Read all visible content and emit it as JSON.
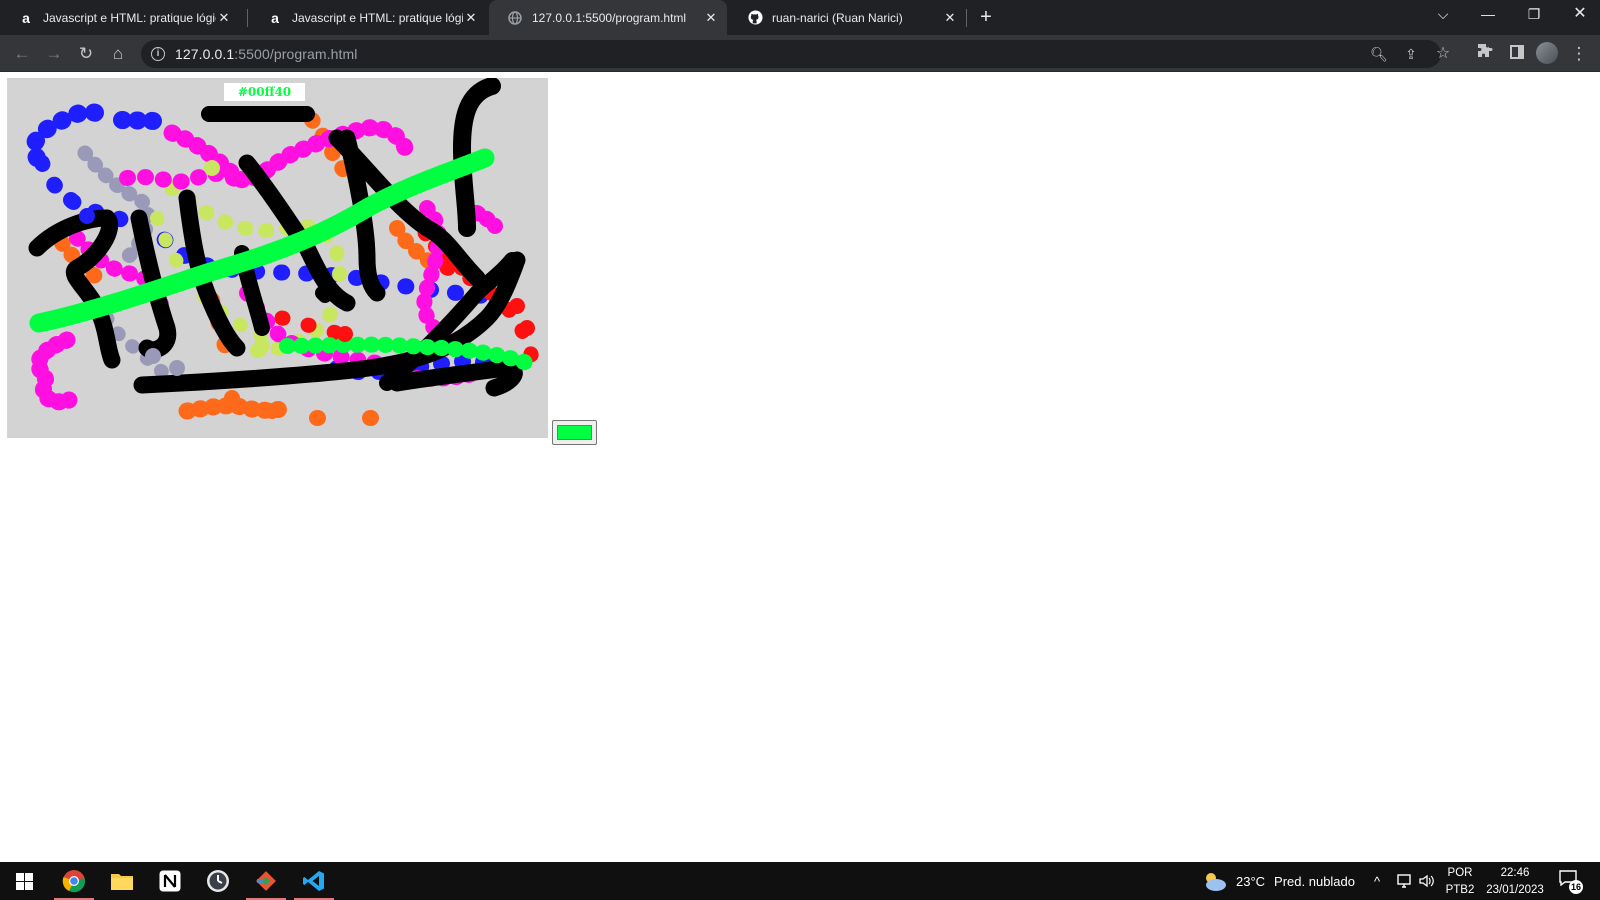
{
  "browser": {
    "tabs": [
      {
        "title": "Javascript e HTML: pratique lógica",
        "icon": "alura-icon",
        "active": false
      },
      {
        "title": "Javascript e HTML: pratique lógica",
        "icon": "alura-icon",
        "active": false
      },
      {
        "title": "127.0.0.1:5500/program.html",
        "icon": "globe-icon",
        "active": true
      },
      {
        "title": "ruan-narici (Ruan Narici)",
        "icon": "github-icon",
        "active": false
      }
    ],
    "url_host": "127.0.0.1",
    "url_rest": ":5500/program.html"
  },
  "page": {
    "color_label": "#00ff40",
    "selected_color": "#00ff40",
    "canvas_background": "#d3d3d3"
  },
  "taskbar": {
    "weather_temp": "23°C",
    "weather_text": "Pred. nublado",
    "lang_top": "POR",
    "lang_bottom": "PTB2",
    "time": "22:46",
    "date": "23/01/2023",
    "notification_count": "16"
  }
}
